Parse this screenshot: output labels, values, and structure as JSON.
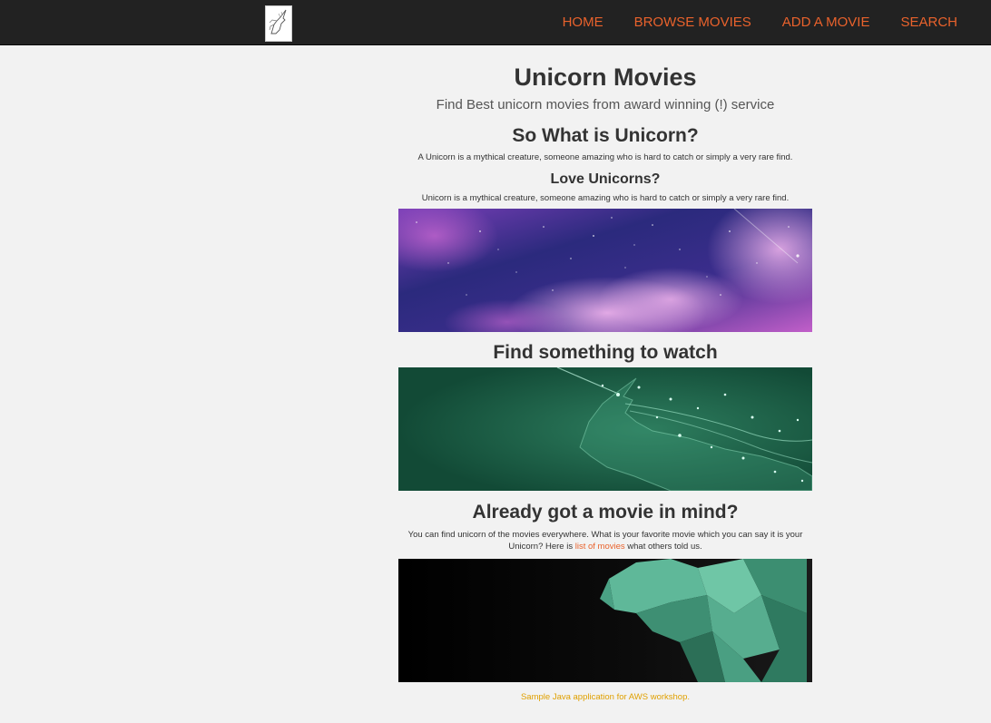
{
  "navbar": {
    "logo_icon": "unicorn-logo-icon",
    "links": [
      "HOME",
      "BROWSE MOVIES",
      "ADD A MOVIE",
      "SEARCH"
    ]
  },
  "hero": {
    "title": "Unicorn Movies",
    "subtitle": "Find Best unicorn movies from award winning (!) service"
  },
  "section_what": {
    "heading": "So What is Unicorn?",
    "text": "A Unicorn is a mythical creature, someone amazing who is hard to catch or simply a very rare find."
  },
  "section_love": {
    "heading": "Love Unicorns?",
    "text": "Unicorn is a mythical creature, someone amazing who is hard to catch or simply a very rare find."
  },
  "section_find": {
    "heading": "Find something to watch"
  },
  "section_mind": {
    "heading": "Already got a movie in mind?",
    "text_before": "You can find unicorn of the movies everywhere. What is your favorite movie which you can say it is your Unicorn? Here is ",
    "link_text": "list of movies",
    "text_after": " what others told us."
  },
  "footer": {
    "text": "Sample Java application for AWS workshop."
  },
  "colors": {
    "accent": "#e9622c",
    "navbar_bg": "#222222",
    "page_bg": "#f2f2f2",
    "footer_text": "#e0a000"
  },
  "images": {
    "banner1": "galaxy-banner-image",
    "banner2": "glowing-unicorn-banner-image",
    "banner3": "paper-unicorn-banner-image"
  }
}
